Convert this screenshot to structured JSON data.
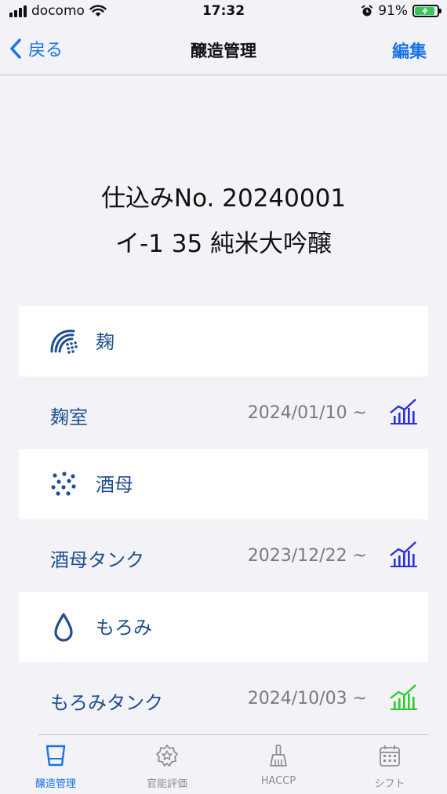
{
  "status_bar": {
    "carrier": "docomo",
    "time": "17:32",
    "battery_percent": "91%",
    "battery_level": 0.91
  },
  "nav": {
    "back_label": "戻る",
    "title": "醸造管理",
    "edit_label": "編集"
  },
  "batch": {
    "number": "仕込みNo. 20240001",
    "name": "イ-1 35 純米大吟醸"
  },
  "sections": [
    {
      "label": "麹",
      "icon": "koji-icon",
      "row": {
        "label": "麹室",
        "date": "2024/01/10 ~",
        "chart_icon": "chart-icon",
        "chart_color": "#2d2fd6"
      }
    },
    {
      "label": "酒母",
      "icon": "dots-icon",
      "row": {
        "label": "酒母タンク",
        "date": "2023/12/22 ~",
        "chart_icon": "chart-icon",
        "chart_color": "#2d2fd6"
      }
    },
    {
      "label": "もろみ",
      "icon": "droplet-icon",
      "row": {
        "label": "もろみタンク",
        "date": "2024/10/03 ~",
        "chart_icon": "chart-icon",
        "chart_color": "#2ecc2e"
      }
    }
  ],
  "tabs": [
    {
      "label": "醸造管理",
      "icon": "glass-icon",
      "active": true
    },
    {
      "label": "官能評価",
      "icon": "star-badge-icon",
      "active": false
    },
    {
      "label": "HACCP",
      "icon": "broom-icon",
      "active": false
    },
    {
      "label": "シフト",
      "icon": "calendar-icon",
      "active": false
    }
  ],
  "colors": {
    "accent": "#1a73e8",
    "label_blue": "#1f4f8f",
    "chart_blue": "#2d2fd6",
    "chart_green": "#2ecc2e"
  }
}
